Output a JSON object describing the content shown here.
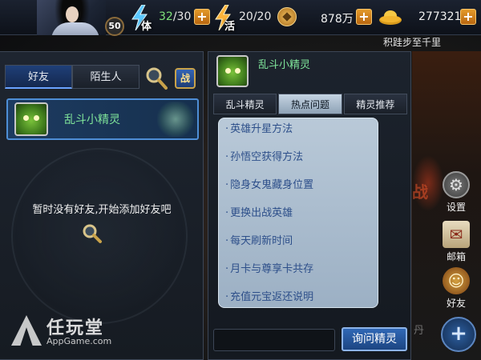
{
  "topbar": {
    "level": "50",
    "stamina_label": "体",
    "stamina_current": "32",
    "stamina_max": "/30",
    "activity_label": "活",
    "activity_value": "20/20",
    "copper_value": "878万",
    "ingot_value": "277321",
    "plus_label": "+",
    "tagline": "积跬步至千里"
  },
  "friends_panel": {
    "tabs": [
      "好友",
      "陌生人"
    ],
    "battle_label": "战",
    "selected_friend": "乱斗小精灵",
    "empty_message": "暂时没有好友,开始添加好友吧"
  },
  "sprite_panel": {
    "title": "乱斗小精灵",
    "tabs": [
      "乱斗精灵",
      "热点问题",
      "精灵推荐"
    ],
    "active_tab_index": 1,
    "faq": [
      "英雄升星方法",
      "孙悟空获得方法",
      "隐身女鬼藏身位置",
      "更换出战英雄",
      "每天刷新时间",
      "月卡与尊享卡共存",
      "充值元宝返还说明"
    ],
    "ask_button": "询问精灵"
  },
  "side_menu": {
    "settings": "设置",
    "mail": "邮箱",
    "friends": "好友",
    "bg_text_1": "战",
    "bg_text_2": "丹"
  },
  "watermark": {
    "title": "任玩堂",
    "url": "AppGame.com"
  },
  "colors": {
    "accent_blue": "#1f3f78",
    "friend_name_green": "#7fe49a",
    "faq_text": "#2d4f8a",
    "plus_orange": "#e49a2a"
  }
}
